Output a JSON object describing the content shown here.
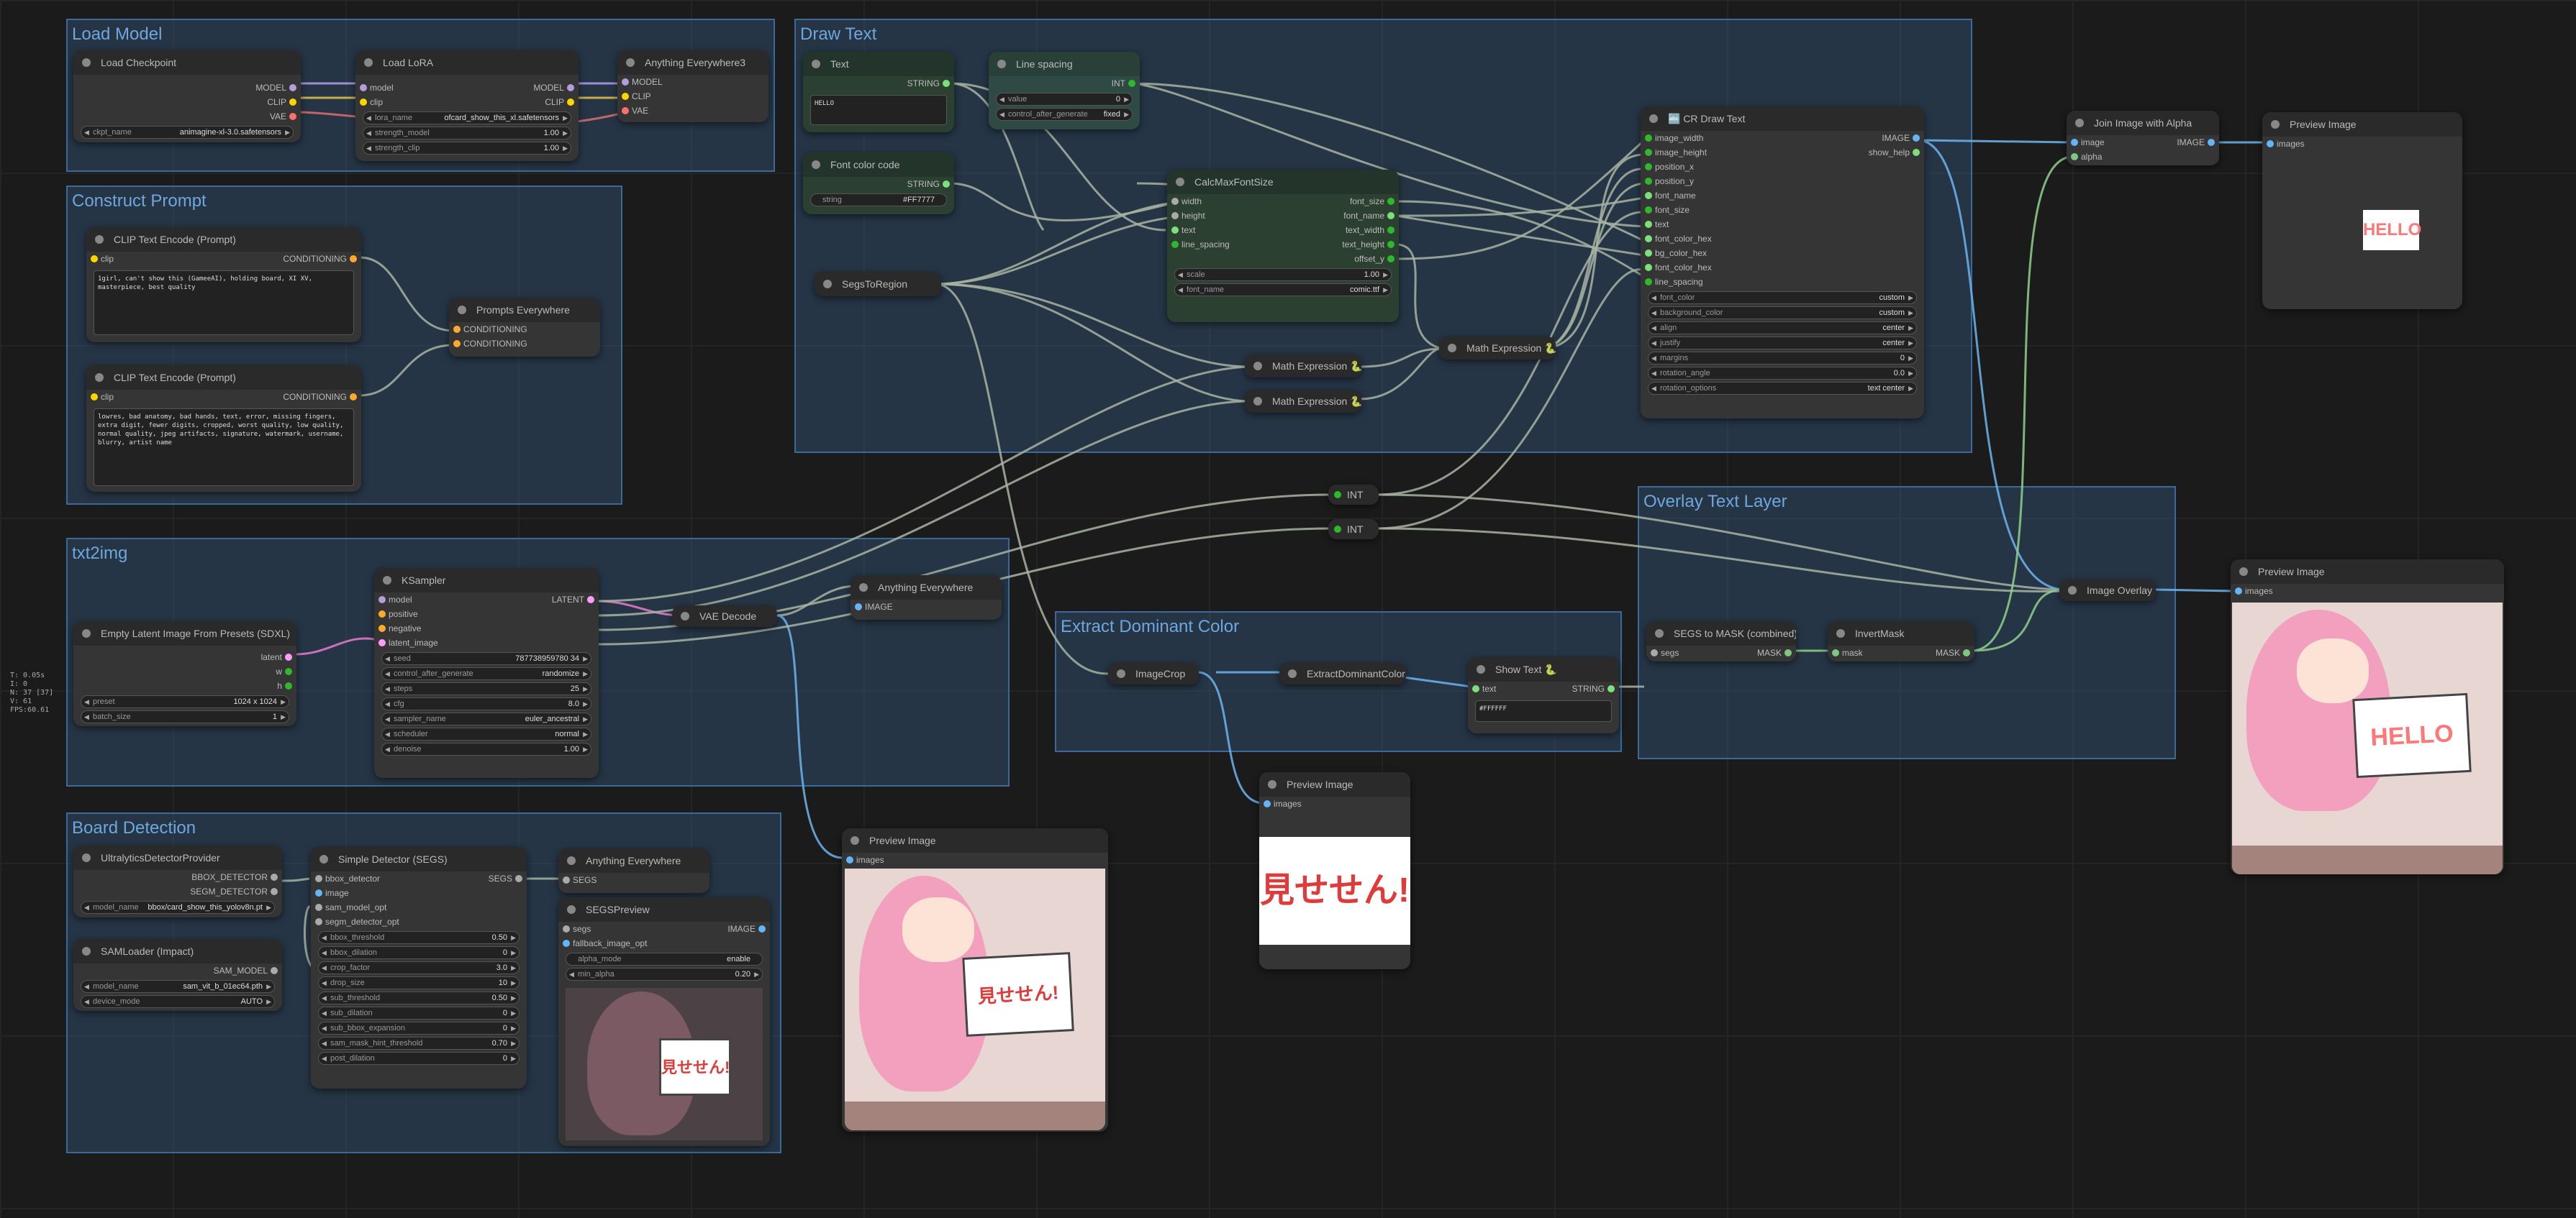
{
  "stats": "T: 0.05s\nI: 0\nN: 37 [37]\nV: 61\nFPS:60.61",
  "groups": {
    "load_model": "Load Model",
    "construct_prompt": "Construct Prompt",
    "draw_text": "Draw Text",
    "txt2img": "txt2img",
    "extract_color": "Extract Dominant Color",
    "overlay": "Overlay Text Layer",
    "board": "Board Detection"
  },
  "nodes": {
    "checkpoint": {
      "title": "Load Checkpoint",
      "out1": "MODEL",
      "out2": "CLIP",
      "out3": "VAE",
      "w_label": "ckpt_name",
      "w_value": "animagine-xl-3.0.safetensors"
    },
    "lora": {
      "title": "Load LoRA",
      "in1": "model",
      "in2": "clip",
      "out1": "MODEL",
      "out2": "CLIP",
      "w1_label": "lora_name",
      "w1_value": "ofcard_show_this_xl.safetensors",
      "w2_label": "strength_model",
      "w2_value": "1.00",
      "w3_label": "strength_clip",
      "w3_value": "1.00"
    },
    "anything3": {
      "title": "Anything Everywhere3",
      "in1": "MODEL",
      "in2": "CLIP",
      "in3": "VAE"
    },
    "clip_pos": {
      "title": "CLIP Text Encode (Prompt)",
      "in": "clip",
      "out": "CONDITIONING",
      "text": "1girl, can't show this (GameeAI), holding board, XI XV, masterpiece, best quality"
    },
    "clip_neg": {
      "title": "CLIP Text Encode (Prompt)",
      "in": "clip",
      "out": "CONDITIONING",
      "text": "lowres, bad anatomy, bad hands, text, error, missing fingers, extra digit, fewer digits, cropped, worst quality, low quality, normal quality, jpeg artifacts, signature, watermark, username, blurry, artist name"
    },
    "prompts_everywhere": {
      "title": "Prompts Everywhere",
      "in1": "CONDITIONING",
      "in2": "CONDITIONING"
    },
    "text": {
      "title": "Text",
      "out": "STRING",
      "value": "HELLO"
    },
    "line_spacing": {
      "title": "Line spacing",
      "out": "INT",
      "w1_label": "value",
      "w1_value": "0",
      "w2_label": "control_after_generate",
      "w2_value": "fixed"
    },
    "font_color": {
      "title": "Font color code",
      "out": "STRING",
      "w_label": "string",
      "w_value": "#FF7777"
    },
    "segs_to_region": {
      "title": "SegsToRegion"
    },
    "calcmax": {
      "title": "CalcMaxFontSize",
      "in1": "width",
      "in2": "height",
      "in3": "text",
      "in4": "line_spacing",
      "out1": "font_size",
      "out2": "font_name",
      "out3": "text_width",
      "out4": "text_height",
      "out5": "offset_y",
      "w1_label": "scale",
      "w1_value": "1.00",
      "w2_label": "font_name",
      "w2_value": "comic.ttf"
    },
    "math1": {
      "title": "Math Expression 🐍"
    },
    "math2": {
      "title": "Math Expression 🐍"
    },
    "math3": {
      "title": "Math Expression 🐍"
    },
    "draw_text": {
      "title": "🔤 CR Draw Text",
      "out1": "IMAGE",
      "out2": "show_help",
      "inputs": [
        "image_width",
        "image_height",
        "position_x",
        "position_y",
        "font_name",
        "font_size",
        "text",
        "font_color_hex",
        "bg_color_hex",
        "font_color_hex",
        "line_spacing"
      ],
      "widgets": [
        [
          "font_color",
          "custom"
        ],
        [
          "background_color",
          "custom"
        ],
        [
          "align",
          "center"
        ],
        [
          "justify",
          "center"
        ],
        [
          "margins",
          "0"
        ],
        [
          "rotation_angle",
          "0.0"
        ],
        [
          "rotation_options",
          "text center"
        ]
      ]
    },
    "join_alpha": {
      "title": "Join Image with Alpha",
      "in1": "image",
      "in2": "alpha",
      "out": "IMAGE"
    },
    "preview1": {
      "title": "Preview Image",
      "in": "images",
      "sign": "HELLO"
    },
    "int1": {
      "title": "INT"
    },
    "int2": {
      "title": "INT"
    },
    "empty_latent": {
      "title": "Empty Latent Image From Presets (SDXL)",
      "out1": "latent",
      "out2": "w",
      "out3": "h",
      "w1_label": "preset",
      "w1_value": "1024 x 1024",
      "w2_label": "batch_size",
      "w2_value": "1"
    },
    "ksampler": {
      "title": "KSampler",
      "in1": "model",
      "in2": "positive",
      "in3": "negative",
      "in4": "latent_image",
      "out": "LATENT",
      "widgets": [
        [
          "seed",
          "787738959780 34"
        ],
        [
          "control_after_generate",
          "randomize"
        ],
        [
          "steps",
          "25"
        ],
        [
          "cfg",
          "8.0"
        ],
        [
          "sampler_name",
          "euler_ancestral"
        ],
        [
          "scheduler",
          "normal"
        ],
        [
          "denoise",
          "1.00"
        ]
      ]
    },
    "vae_decode": {
      "title": "VAE Decode"
    },
    "anything_img": {
      "title": "Anything Everywhere",
      "in": "IMAGE"
    },
    "segs_mask": {
      "title": "SEGS to MASK (combined)",
      "in": "segs",
      "out": "MASK"
    },
    "invert_mask": {
      "title": "InvertMask",
      "in": "mask",
      "out": "MASK"
    },
    "image_overlay": {
      "title": "Image Overlay"
    },
    "preview2": {
      "title": "Preview Image",
      "in": "images",
      "sign": "HELLO"
    },
    "imagecrop": {
      "title": "ImageCrop"
    },
    "extract_dom": {
      "title": "ExtractDominantColor"
    },
    "show_text": {
      "title": "Show Text 🐍",
      "in": "text",
      "out": "STRING",
      "value": "#FFFFFF"
    },
    "preview3": {
      "title": "Preview Image",
      "in": "images",
      "sign": "見せせん!"
    },
    "preview4": {
      "title": "Preview Image",
      "in": "images",
      "sign": "見せせん!"
    },
    "ultralytics": {
      "title": "UltralyticsDetectorProvider",
      "out1": "BBOX_DETECTOR",
      "out2": "SEGM_DETECTOR",
      "w_label": "model_name",
      "w_value": "bbox/card_show_this_yolov8n.pt"
    },
    "samloader": {
      "title": "SAMLoader (Impact)",
      "out": "SAM_MODEL",
      "w1_label": "model_name",
      "w1_value": "sam_vit_b_01ec64.pth",
      "w2_label": "device_mode",
      "w2_value": "AUTO"
    },
    "simple_detector": {
      "title": "Simple Detector (SEGS)",
      "in1": "bbox_detector",
      "in2": "image",
      "in3": "sam_model_opt",
      "in4": "segm_detector_opt",
      "out": "SEGS",
      "widgets": [
        [
          "bbox_threshold",
          "0.50"
        ],
        [
          "bbox_dilation",
          "0"
        ],
        [
          "crop_factor",
          "3.0"
        ],
        [
          "drop_size",
          "10"
        ],
        [
          "sub_threshold",
          "0.50"
        ],
        [
          "sub_dilation",
          "0"
        ],
        [
          "sub_bbox_expansion",
          "0"
        ],
        [
          "sam_mask_hint_threshold",
          "0.70"
        ],
        [
          "post_dilation",
          "0"
        ]
      ]
    },
    "anything_segs": {
      "title": "Anything Everywhere",
      "in": "SEGS"
    },
    "segs_preview": {
      "title": "SEGSPreview",
      "in1": "segs",
      "in2": "fallback_image_opt",
      "out": "IMAGE",
      "w1_label": "alpha_mode",
      "w1_value": "enable",
      "w2_label": "min_alpha",
      "w2_value": "0.20",
      "sign": "見せせん!"
    }
  }
}
